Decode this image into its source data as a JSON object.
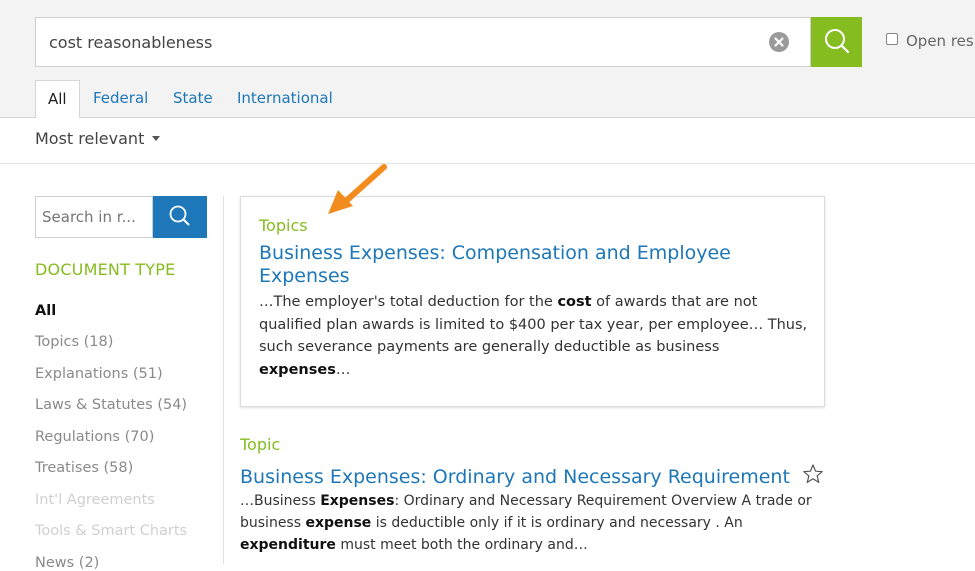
{
  "search": {
    "value": "cost reasonableness",
    "open_results_label": "Open res"
  },
  "tabs": [
    {
      "label": "All",
      "active": true
    },
    {
      "label": "Federal"
    },
    {
      "label": "State"
    },
    {
      "label": "International"
    }
  ],
  "sort": {
    "label": "Most relevant"
  },
  "sidebar": {
    "search_placeholder": "Search in r...",
    "doc_type_heading": "DOCUMENT TYPE",
    "filters": [
      {
        "label": "All",
        "state": "active"
      },
      {
        "label": "Topics (18)"
      },
      {
        "label": "Explanations (51)"
      },
      {
        "label": "Laws & Statutes (54)"
      },
      {
        "label": "Regulations (70)"
      },
      {
        "label": "Treatises (58)"
      },
      {
        "label": "Int'l Agreements",
        "state": "disabled"
      },
      {
        "label": "Tools & Smart Charts",
        "state": "disabled"
      },
      {
        "label": "News (2)"
      }
    ]
  },
  "results": [
    {
      "type": "Topics",
      "title_line1": "Business Expenses: Compensation and Employee",
      "title_line2": "Expenses",
      "snippet": [
        [
          "…The employer's total deduction for the ",
          false
        ],
        [
          "cost",
          true
        ],
        [
          " of awards that are not qualified plan awards is limited to $400 per tax year, per employee… Thus, such severance payments are generally deductible as business ",
          false
        ],
        [
          "expenses",
          true
        ],
        [
          "…",
          false
        ]
      ]
    },
    {
      "type": "Topic",
      "title": "Business Expenses: Ordinary and Necessary Requirement",
      "snippet": [
        [
          "…Business ",
          false
        ],
        [
          "Expenses",
          true
        ],
        [
          ": Ordinary and Necessary Requirement Overview A trade or business ",
          false
        ],
        [
          "expense",
          true
        ],
        [
          " is deductible only if it is ordinary and necessary . An ",
          false
        ],
        [
          "expenditure",
          true
        ],
        [
          " must meet both the ordinary and…",
          false
        ]
      ]
    }
  ],
  "colors": {
    "accent_green": "#85bc20",
    "link_blue": "#1d77b8",
    "arrow_orange": "#f28c1e"
  },
  "icons": [
    "clear-icon",
    "search-icon",
    "star-icon",
    "arrow-annotation"
  ]
}
